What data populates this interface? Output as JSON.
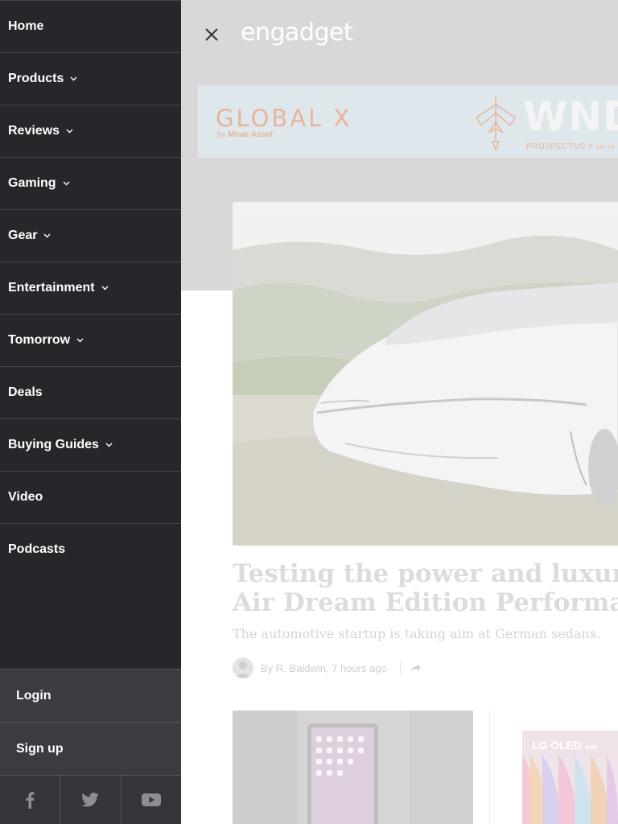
{
  "sidebar": {
    "items": [
      {
        "label": "Home",
        "has_dropdown": false
      },
      {
        "label": "Products",
        "has_dropdown": true
      },
      {
        "label": "Reviews",
        "has_dropdown": true
      },
      {
        "label": "Gaming",
        "has_dropdown": true
      },
      {
        "label": "Gear",
        "has_dropdown": true
      },
      {
        "label": "Entertainment",
        "has_dropdown": true
      },
      {
        "label": "Tomorrow",
        "has_dropdown": true
      },
      {
        "label": "Deals",
        "has_dropdown": false
      },
      {
        "label": "Buying Guides",
        "has_dropdown": true
      },
      {
        "label": "Video",
        "has_dropdown": false
      },
      {
        "label": "Podcasts",
        "has_dropdown": false
      }
    ],
    "login_label": "Login",
    "signup_label": "Sign up",
    "social": [
      "facebook-icon",
      "twitter-icon",
      "youtube-icon"
    ]
  },
  "header": {
    "logo_text": "engadget",
    "close_icon": "close-icon"
  },
  "ad": {
    "brand": "GLOBAL X",
    "brand_by": "by",
    "brand_company": "Mirae Asset",
    "ticker": "WND",
    "prospectus": "PROSPECTUS >",
    "prospectus_tail": "SEI IN"
  },
  "article": {
    "headline_line1": "Testing the power and luxury of t",
    "headline_line2": "Air Dream Edition Performance E",
    "subhead": "The automotive startup is taking aim at German sedans.",
    "byline": "By R. Baldwin, 7 hours ago"
  },
  "cards": {
    "card2_brand": "LG OLED",
    "card2_suffix": "evo"
  },
  "colors": {
    "sidebar_bg": "#26272b",
    "auth_bg": "#3b3c41",
    "overlay_grey": "#d8d8d8"
  }
}
